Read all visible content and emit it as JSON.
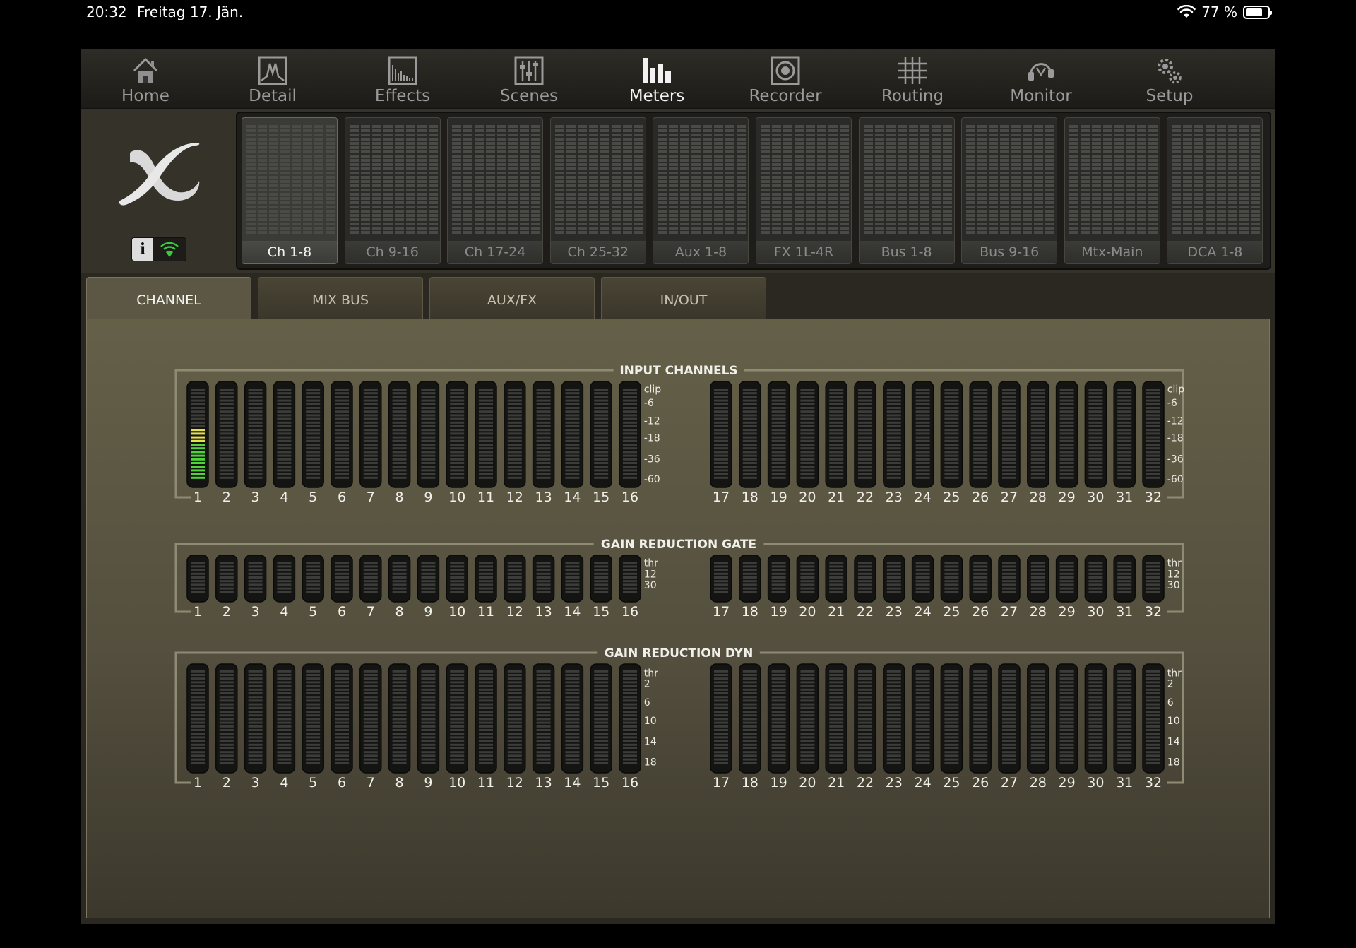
{
  "status_bar": {
    "time": "20:32",
    "date": "Freitag 17. Jän.",
    "battery": "77 %",
    "battery_level": 0.77
  },
  "nav": {
    "active": "Meters",
    "items": [
      {
        "label": "Home",
        "icon": "home-icon"
      },
      {
        "label": "Detail",
        "icon": "detail-icon"
      },
      {
        "label": "Effects",
        "icon": "effects-icon"
      },
      {
        "label": "Scenes",
        "icon": "scenes-icon"
      },
      {
        "label": "Meters",
        "icon": "meters-icon"
      },
      {
        "label": "Recorder",
        "icon": "recorder-icon"
      },
      {
        "label": "Routing",
        "icon": "routing-icon"
      },
      {
        "label": "Monitor",
        "icon": "monitor-icon"
      },
      {
        "label": "Setup",
        "icon": "setup-icon"
      }
    ]
  },
  "info_button": {
    "label": "i"
  },
  "banks": {
    "active": "Ch 1-8",
    "items": [
      "Ch 1-8",
      "Ch 9-16",
      "Ch 17-24",
      "Ch 25-32",
      "Aux 1-8",
      "FX 1L-4R",
      "Bus 1-8",
      "Bus 9-16",
      "Mtx-Main",
      "DCA 1-8"
    ]
  },
  "tabs": {
    "active": "CHANNEL",
    "items": [
      "CHANNEL",
      "MIX BUS",
      "AUX/FX",
      "IN/OUT"
    ]
  },
  "sections": [
    {
      "title": "INPUT CHANNELS",
      "scale": [
        "clip",
        "-6",
        "-12",
        "-18",
        "-36",
        "-60"
      ],
      "channels_left": [
        "1",
        "2",
        "3",
        "4",
        "5",
        "6",
        "7",
        "8",
        "9",
        "10",
        "11",
        "12",
        "13",
        "14",
        "15",
        "16"
      ],
      "channels_right": [
        "17",
        "18",
        "19",
        "20",
        "21",
        "22",
        "23",
        "24",
        "25",
        "26",
        "27",
        "28",
        "29",
        "30",
        "31",
        "32"
      ],
      "levels": [
        0.55,
        0,
        0,
        0,
        0,
        0,
        0,
        0,
        0,
        0,
        0,
        0,
        0,
        0,
        0,
        0,
        0,
        0,
        0,
        0,
        0,
        0,
        0,
        0,
        0,
        0,
        0,
        0,
        0,
        0,
        0,
        0
      ]
    },
    {
      "title": "GAIN REDUCTION GATE",
      "scale": [
        "thr",
        "12",
        "30"
      ],
      "channels_left": [
        "1",
        "2",
        "3",
        "4",
        "5",
        "6",
        "7",
        "8",
        "9",
        "10",
        "11",
        "12",
        "13",
        "14",
        "15",
        "16"
      ],
      "channels_right": [
        "17",
        "18",
        "19",
        "20",
        "21",
        "22",
        "23",
        "24",
        "25",
        "26",
        "27",
        "28",
        "29",
        "30",
        "31",
        "32"
      ]
    },
    {
      "title": "GAIN REDUCTION DYN",
      "scale": [
        "thr",
        "2",
        "6",
        "10",
        "14",
        "18"
      ],
      "channels_left": [
        "1",
        "2",
        "3",
        "4",
        "5",
        "6",
        "7",
        "8",
        "9",
        "10",
        "11",
        "12",
        "13",
        "14",
        "15",
        "16"
      ],
      "channels_right": [
        "17",
        "18",
        "19",
        "20",
        "21",
        "22",
        "23",
        "24",
        "25",
        "26",
        "27",
        "28",
        "29",
        "30",
        "31",
        "32"
      ]
    }
  ]
}
